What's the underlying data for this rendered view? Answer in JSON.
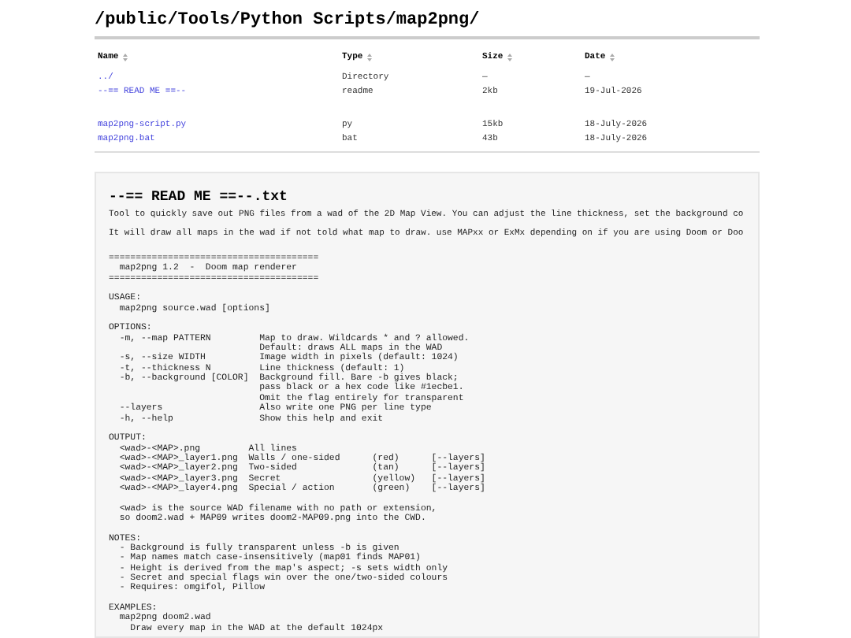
{
  "title": "/public/Tools/Python Scripts/map2png/",
  "table": {
    "columns": [
      "Name",
      "Type",
      "Size",
      "Date"
    ],
    "row_groups": [
      [
        {
          "name": "../",
          "type": "Directory",
          "size": "—",
          "date": "—"
        },
        {
          "name": "--== READ ME ==--",
          "type": "readme",
          "size": "2kb",
          "date": "19-Jul-2026"
        }
      ],
      [
        {
          "name": "map2png-script.py",
          "type": "py",
          "size": "15kb",
          "date": "18-July-2026"
        },
        {
          "name": "map2png.bat",
          "type": "bat",
          "size": "43b",
          "date": "18-July-2026"
        }
      ]
    ]
  },
  "readme": {
    "title": "--== READ ME ==--.txt",
    "paragraphs": [
      "Tool to quickly save out PNG files from a wad of the 2D Map View. You can adjust the line thickness, set the background co",
      "It will draw all maps in the wad if not told what map to draw. use MAPxx or ExMx depending on if you are using Doom or Doo"
    ],
    "code": "=======================================\n  map2png 1.2  -  Doom map renderer\n=======================================\n\nUSAGE:\n  map2png source.wad [options]\n\nOPTIONS:\n  -m, --map PATTERN         Map to draw. Wildcards * and ? allowed.\n                            Default: draws ALL maps in the WAD\n  -s, --size WIDTH          Image width in pixels (default: 1024)\n  -t, --thickness N         Line thickness (default: 1)\n  -b, --background [COLOR]  Background fill. Bare -b gives black;\n                            pass black or a hex code like #1ecbe1.\n                            Omit the flag entirely for transparent\n  --layers                  Also write one PNG per line type\n  -h, --help                Show this help and exit\n\nOUTPUT:\n  <wad>-<MAP>.png         All lines\n  <wad>-<MAP>_layer1.png  Walls / one-sided      (red)      [--layers]\n  <wad>-<MAP>_layer2.png  Two-sided              (tan)      [--layers]\n  <wad>-<MAP>_layer3.png  Secret                 (yellow)   [--layers]\n  <wad>-<MAP>_layer4.png  Special / action       (green)    [--layers]\n\n  <wad> is the source WAD filename with no path or extension,\n  so doom2.wad + MAP09 writes doom2-MAP09.png into the CWD.\n\nNOTES:\n  - Background is fully transparent unless -b is given\n  - Map names match case-insensitively (map01 finds MAP01)\n  - Height is derived from the map's aspect; -s sets width only\n  - Secret and special flags win over the one/two-sided colours\n  - Requires: omgifol, Pillow\n\nEXAMPLES:\n  map2png doom2.wad\n    Draw every map in the WAD at the default 1024px"
  }
}
